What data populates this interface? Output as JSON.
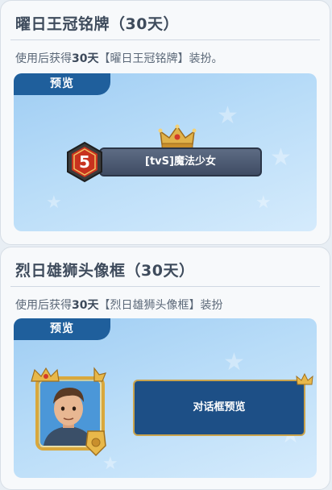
{
  "cards": [
    {
      "title": "曜日王冠铭牌（30天）",
      "desc_prefix": "使用后获得",
      "desc_days": "30天",
      "desc_suffix": "【曜日王冠铭牌】装扮。",
      "preview_label": "预览",
      "nameplate": {
        "level": "5",
        "text": "[tvS]魔法少女"
      }
    },
    {
      "title": "烈日雄狮头像框（30天）",
      "desc_prefix": "使用后获得",
      "desc_days": "30天",
      "desc_suffix": "【烈日雄狮头像框】装扮",
      "preview_label": "预览",
      "dialog": {
        "text": "对话框预览"
      }
    }
  ],
  "colors": {
    "tab": "#1f5f9c",
    "dialog": "#1d4f86",
    "gold": "#e0b24a",
    "badge_red": "#c8321e"
  },
  "icons": [
    "crown-icon",
    "level-badge-icon",
    "avatar-frame-icon",
    "star-icon"
  ]
}
